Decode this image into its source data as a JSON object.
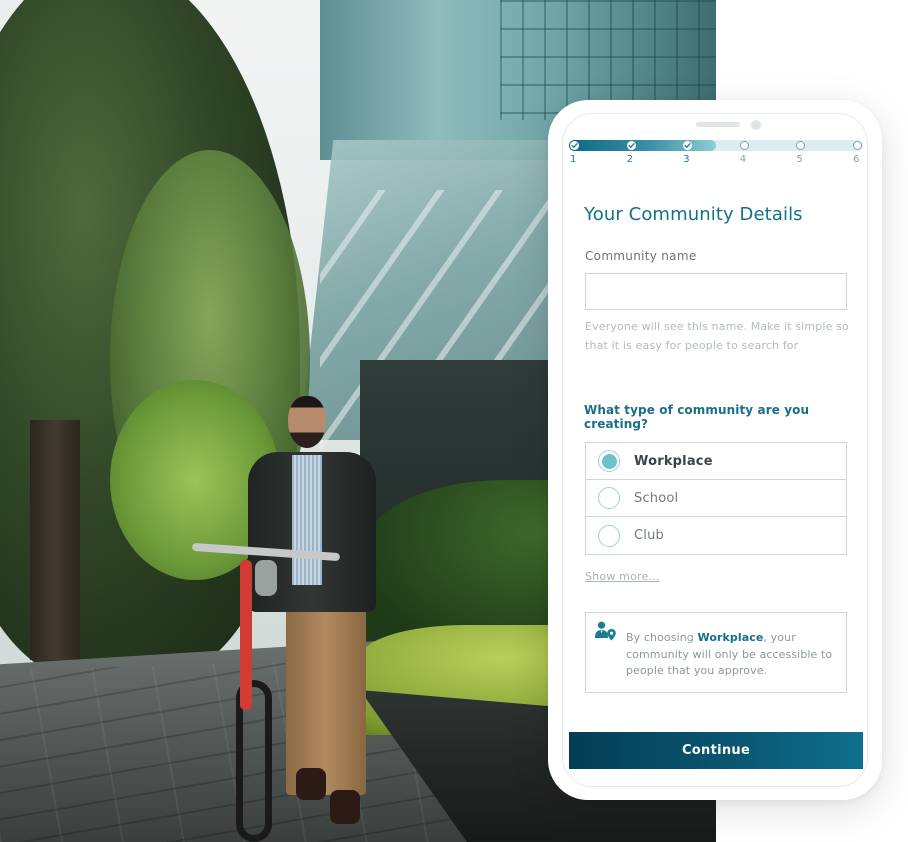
{
  "background_photo": {
    "description": "Man with beard and glasses walking a red bicycle on a city sidewalk beside trees and a glass office building"
  },
  "stepper": {
    "total_steps": 6,
    "completed_steps": 3,
    "progress_fraction": 0.5,
    "steps": [
      {
        "number": "1",
        "state": "done"
      },
      {
        "number": "2",
        "state": "done"
      },
      {
        "number": "3",
        "state": "done"
      },
      {
        "number": "4",
        "state": "todo"
      },
      {
        "number": "5",
        "state": "todo"
      },
      {
        "number": "6",
        "state": "todo"
      }
    ]
  },
  "form": {
    "title": "Your Community Details",
    "name_label": "Community name",
    "name_value": "",
    "name_placeholder": "",
    "name_hint": "Everyone will see this name. Make it simple so that it is easy for people to search for",
    "type_question": "What type of community are you creating?",
    "type_options": [
      {
        "label": "Workplace",
        "selected": true
      },
      {
        "label": "School",
        "selected": false
      },
      {
        "label": "Club",
        "selected": false
      }
    ],
    "show_more": "Show more...",
    "info": {
      "icon": "user-location-icon",
      "prefix": "By choosing ",
      "highlight": "Workplace",
      "suffix": ", your community will only be accessible to people that you approve."
    },
    "continue_label": "Continue"
  },
  "colors": {
    "primary": "#117189",
    "button_start": "#033e54",
    "button_end": "#0e6f8c",
    "radio_selected": "#6cc1cb",
    "stepper_track": "#dbedf0"
  }
}
